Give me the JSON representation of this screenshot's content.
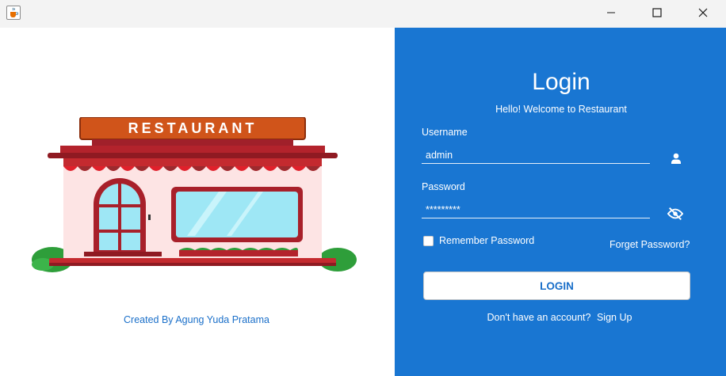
{
  "window": {
    "icons": {
      "app": "java-cup-icon",
      "minimize": "minimize-icon",
      "maximize": "maximize-icon",
      "close": "close-icon"
    }
  },
  "left": {
    "sign_text": "RESTAURANT",
    "credit": "Created By Agung Yuda Pratama"
  },
  "login": {
    "title": "Login",
    "subtitle": "Hello! Welcome to Restaurant",
    "username_label": "Username",
    "username_value": "admin",
    "password_label": "Password",
    "password_value": "*********",
    "remember_label": "Remember Password",
    "remember_checked": false,
    "forget_label": "Forget Password?",
    "button_label": "LOGIN",
    "no_account_text": "Don't have an account?",
    "signup_label": "Sign Up",
    "icons": {
      "user": "user-icon",
      "password_toggle": "eye-off-icon"
    }
  },
  "colors": {
    "accent": "#1976d2",
    "link": "#1a6fc9",
    "button_bg": "#ffffff"
  }
}
